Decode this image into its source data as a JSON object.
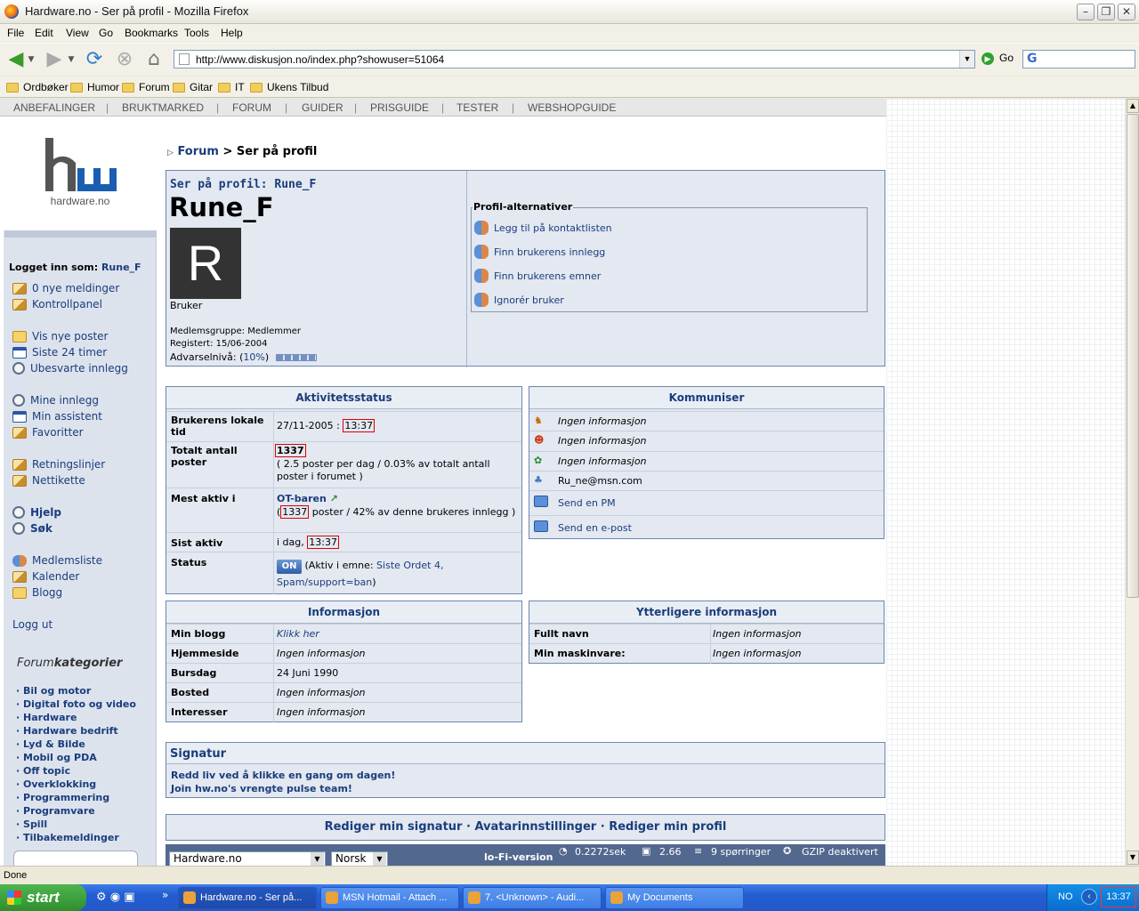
{
  "window": {
    "title": "Hardware.no - Ser på profil - Mozilla Firefox"
  },
  "menu": [
    "File",
    "Edit",
    "View",
    "Go",
    "Bookmarks",
    "Tools",
    "Help"
  ],
  "address": {
    "url": "http://www.diskusjon.no/index.php?showuser=51064",
    "go_label": "Go"
  },
  "bookmarks": [
    "Ordbøker",
    "Humor",
    "Forum",
    "Gitar",
    "IT",
    "Ukens Tilbud"
  ],
  "sitenav": [
    "ANBEFALINGER",
    "BRUKTMARKED",
    "FORUM",
    "GUIDER",
    "PRISGUIDE",
    "TESTER",
    "WEBSHOPGUIDE"
  ],
  "sidebar": {
    "logo_text": "hardware.no",
    "logged_in_label": "Logget inn som:",
    "logged_in_user": "Rune_F",
    "items": [
      "0 nye meldinger",
      "Kontrollpanel",
      "Vis nye poster",
      "Siste 24 timer",
      "Ubesvarte innlegg",
      "Mine innlegg",
      "Min assistent",
      "Favoritter",
      "Retningslinjer",
      "Nettikette",
      "Hjelp",
      "Søk",
      "Medlemsliste",
      "Kalender",
      "Blogg",
      "Logg ut"
    ],
    "cat_title_a": "Forum",
    "cat_title_b": "kategorier",
    "categories": [
      "Bil og motor",
      "Digital foto og video",
      "Hardware",
      "Hardware bedrift",
      "Lyd & Bilde",
      "Mobil og PDA",
      "Off topic",
      "Overklokking",
      "Programmering",
      "Programvare",
      "Spill",
      "Tilbakemeldinger"
    ]
  },
  "breadcrumb": {
    "forum": "Forum",
    "sep": ">",
    "current": "Ser på profil"
  },
  "profile": {
    "header": "Ser på profil: Rune_F",
    "name": "Rune_F",
    "avatar_letter": "R",
    "role": "Bruker",
    "group": "Medlemsgruppe: Medlemmer",
    "registered": "Registert: 15/06-2004",
    "warn_label": "Advarselnivå: (",
    "warn_pct": "10%",
    "warn_close": ")",
    "options_title": "Profil-alternativer",
    "options": [
      "Legg til på kontaktlisten",
      "Finn brukerens innlegg",
      "Finn brukerens emner",
      "Ignorér bruker"
    ]
  },
  "activity": {
    "title": "Aktivitetsstatus",
    "local_time_label": "Brukerens lokale tid",
    "local_date": "27/11-2005 :",
    "local_time": "13:37",
    "total_label": "Totalt antall poster",
    "total": "1337",
    "total_detail": "( 2.5 poster per dag / 0.03% av totalt antall poster i forumet )",
    "most_active_label": "Mest aktiv i",
    "most_active_forum": "OT-baren",
    "most_active_open": "(",
    "most_active_count": "1337",
    "most_active_detail": " poster / 42% av denne brukeres innlegg )",
    "last_active_label": "Sist aktiv",
    "last_active_prefix": "i dag,",
    "last_active_time": "13:37",
    "status_label": "Status",
    "status_badge": "ON",
    "status_text": "(Aktiv i emne:",
    "status_topic": "Siste Ordet 4, Spam/support=ban",
    "status_close": ")"
  },
  "communicate": {
    "title": "Kommuniser",
    "rows": [
      "Ingen informasjon",
      "Ingen informasjon",
      "Ingen informasjon",
      "Ru_ne@msn.com",
      "Send en PM",
      "Send en e-post"
    ]
  },
  "info": {
    "title": "Informasjon",
    "rows": [
      {
        "label": "Min blogg",
        "value": "Klikk her"
      },
      {
        "label": "Hjemmeside",
        "value": "Ingen informasjon"
      },
      {
        "label": "Bursdag",
        "value": "24 Juni 1990"
      },
      {
        "label": "Bosted",
        "value": "Ingen informasjon"
      },
      {
        "label": "Interesser",
        "value": "Ingen informasjon"
      }
    ]
  },
  "extra": {
    "title": "Ytterligere informasjon",
    "rows": [
      {
        "label": "Fullt navn",
        "value": "Ingen informasjon"
      },
      {
        "label": "Min maskinvare:",
        "value": "Ingen informasjon"
      }
    ]
  },
  "signature": {
    "title": "Signatur",
    "lines": [
      "Redd liv ved å klikke en gang om dagen!",
      "Join hw.no's vrengte pulse team!"
    ]
  },
  "bottom_links": "Rediger min signatur · Avatarinnstillinger · Rediger min profil",
  "footer": {
    "site_select": "Hardware.no",
    "lang_select": "Norsk",
    "lofi": "lo-Fi-version",
    "time": "0.2272sek",
    "load": "2.66",
    "queries": "9 spørringer",
    "gzip": "GZIP deaktivert"
  },
  "status_text": "Done",
  "taskbar": {
    "start": "start",
    "tasks": [
      "Hardware.no - Ser på...",
      "MSN Hotmail - Attach ...",
      "7. <Unknown> - Audi...",
      "My Documents"
    ],
    "lang": "NO",
    "clock": "13:37"
  },
  "colors": {
    "accent": "#1a3d7c",
    "panel": "#e3e8f1",
    "border": "#6e87ae",
    "highlight_red": "#dd0000"
  }
}
